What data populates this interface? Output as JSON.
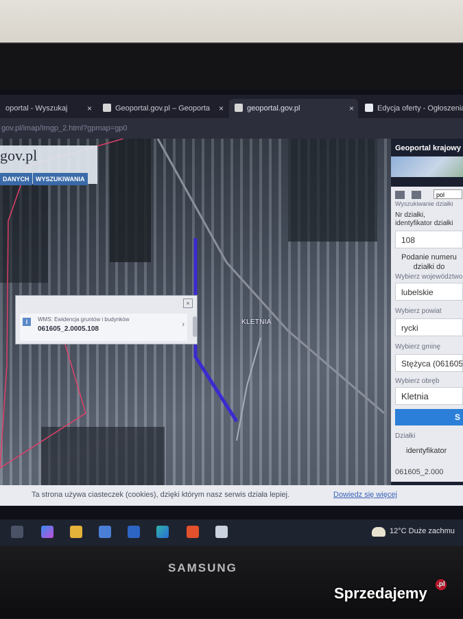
{
  "browser": {
    "tabs": [
      {
        "label": "oportal - Wyszukaj"
      },
      {
        "label": "Geoportal.gov.pl – Geoporta"
      },
      {
        "label": "geoportal.gov.pl"
      },
      {
        "label": "Edycja oferty - Ogłoszenia"
      }
    ],
    "address": "gov.pl/imap/Imgp_2.html?gpmap=gp0",
    "close_glyph": "×"
  },
  "map": {
    "logo": "gov.pl",
    "menu": [
      "DANYCH",
      "WYSZUKIWANIA"
    ],
    "place_label": "KLETNIA",
    "popup": {
      "layer": "WMS: Ewidencja gruntów i budynków",
      "parcel_id": "061605_2.0005.108"
    }
  },
  "panel": {
    "title": "Geoportal krajowy",
    "language": "pol",
    "section": "Wyszukiwanie działki",
    "label_parcel": "Nr działki, identyfikator działki",
    "parcel_number": "108",
    "hint": "Podanie numeru działki do",
    "label_voivodeship": "Wybierz województwo",
    "voivodeship": "lubelskie",
    "label_county": "Wybierz powiat",
    "county": "rycki",
    "label_commune": "Wybierz gminę",
    "commune": "Stężyca (061605",
    "label_precinct": "Wybierz obręb",
    "precinct": "Kletnia",
    "search_label": "S",
    "label_parcels": "Działki",
    "col_identifier": "identyfikator",
    "result": "061605_2.000"
  },
  "cookie": {
    "message": "Ta strona używa ciasteczek (cookies), dzięki którym nasz serwis działa lepiej.",
    "link": "Dowiedz się więcej"
  },
  "taskbar": {
    "weather": "12°C  Duże zachmu"
  },
  "monitor": {
    "brand": "SAMSUNG"
  },
  "watermark": {
    "text": "Sprzedajemy",
    "suffix": ".pl"
  },
  "colors": {
    "parcel_boundary": "#3b2ad0",
    "admin_boundary": "#e0406a",
    "search_button": "#2b7fd8",
    "menu_button": "#3a6aa8"
  }
}
